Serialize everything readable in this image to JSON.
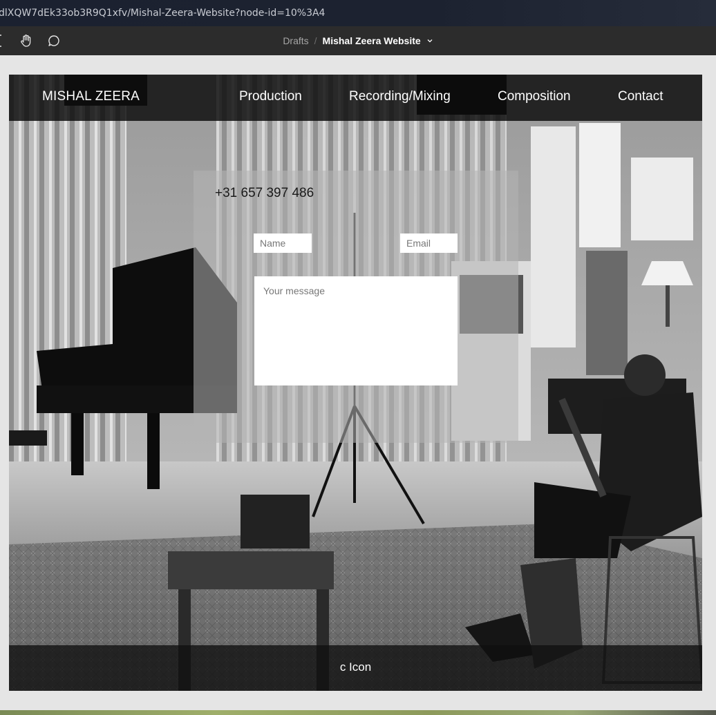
{
  "browser": {
    "url": "dlXQW7dEk33ob3R9Q1xfv/Mishal-Zeera-Website?node-id=10%3A4"
  },
  "toolbar": {
    "tools": [
      {
        "name": "frame-tool-icon"
      },
      {
        "name": "hand-tool-icon"
      },
      {
        "name": "comment-tool-icon"
      }
    ],
    "breadcrumb": {
      "parent": "Drafts",
      "separator": "/",
      "current": "Mishal Zeera Website",
      "dropdown_icon": "chevron-down-icon"
    }
  },
  "site": {
    "brand": "MISHAL ZEERA",
    "nav": [
      {
        "label": "Production"
      },
      {
        "label": "Recording/Mixing"
      },
      {
        "label": "Composition"
      },
      {
        "label": "Contact"
      }
    ],
    "contact": {
      "phone": "+31 657 397 486",
      "name_placeholder": "Name",
      "email_placeholder": "Email",
      "message_placeholder": "Your message"
    },
    "footer_text": "c Icon"
  },
  "colors": {
    "toolbar_bg": "#2c2c2c",
    "canvas_bg": "#e5e5e5",
    "navbar_bg": "#0a0a0a",
    "nav_text": "#ffffff"
  }
}
